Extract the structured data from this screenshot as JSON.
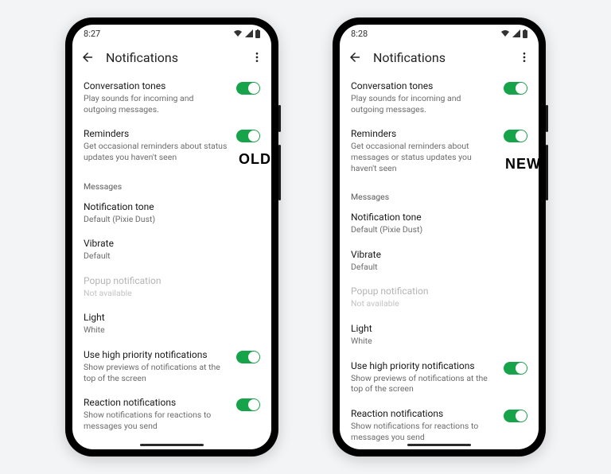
{
  "left": {
    "time": "8:27",
    "tag": "OLD",
    "appbar_title": "Notifications",
    "items": {
      "conv_tones": {
        "label": "Conversation tones",
        "desc": "Play sounds for incoming and outgoing messages."
      },
      "reminders": {
        "label": "Reminders",
        "desc": "Get occasional reminders about status updates you haven't seen"
      },
      "msg_header": "Messages",
      "notif_tone": {
        "label": "Notification tone",
        "desc": "Default (Pixie Dust)"
      },
      "vibrate": {
        "label": "Vibrate",
        "desc": "Default"
      },
      "popup": {
        "label": "Popup notification",
        "desc": "Not available"
      },
      "light": {
        "label": "Light",
        "desc": "White"
      },
      "high_prio": {
        "label": "Use high priority notifications",
        "desc": "Show previews of notifications at the top of the screen"
      },
      "reaction": {
        "label": "Reaction notifications",
        "desc": "Show notifications for reactions to messages you send"
      }
    }
  },
  "right": {
    "time": "8:28",
    "tag": "NEW",
    "appbar_title": "Notifications",
    "items": {
      "conv_tones": {
        "label": "Conversation tones",
        "desc": "Play sounds for incoming and outgoing messages."
      },
      "reminders": {
        "label": "Reminders",
        "desc": "Get occasional reminders about messages or status updates you haven't seen"
      },
      "msg_header": "Messages",
      "notif_tone": {
        "label": "Notification tone",
        "desc": "Default (Pixie Dust)"
      },
      "vibrate": {
        "label": "Vibrate",
        "desc": "Default"
      },
      "popup": {
        "label": "Popup notification",
        "desc": "Not available"
      },
      "light": {
        "label": "Light",
        "desc": "White"
      },
      "high_prio": {
        "label": "Use high priority notifications",
        "desc": "Show previews of notifications at the top of the screen"
      },
      "reaction": {
        "label": "Reaction notifications",
        "desc": "Show notifications for reactions to messages you send"
      }
    }
  }
}
